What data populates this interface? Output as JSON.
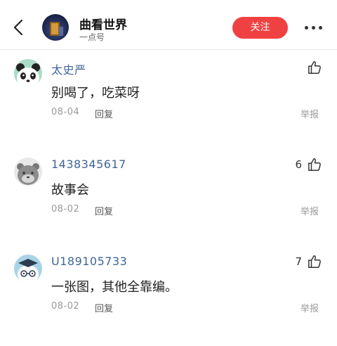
{
  "header": {
    "title": "曲看世界",
    "subtitle": "一点号",
    "follow_label": "关注"
  },
  "comments": [
    {
      "name": "太史严",
      "text": "别喝了，吃菜呀",
      "date": "08-04",
      "reply_label": "回复",
      "report_label": "举报",
      "likes": "",
      "avatar": "panda-avatar"
    },
    {
      "name": "1438345617",
      "text": "故事会",
      "date": "08-02",
      "reply_label": "回复",
      "report_label": "举报",
      "likes": "6",
      "avatar": "gray-cat-avatar"
    },
    {
      "name": "U189105733",
      "text": "一张图，其他全靠编。",
      "date": "08-02",
      "reply_label": "回复",
      "report_label": "举报",
      "likes": "7",
      "avatar": "graduate-avatar"
    }
  ],
  "icons": {
    "back": "back-arrow-icon",
    "more": "more-dots-icon",
    "like": "thumbs-up-icon"
  },
  "colors": {
    "accent": "#f04142",
    "username": "#406599"
  }
}
